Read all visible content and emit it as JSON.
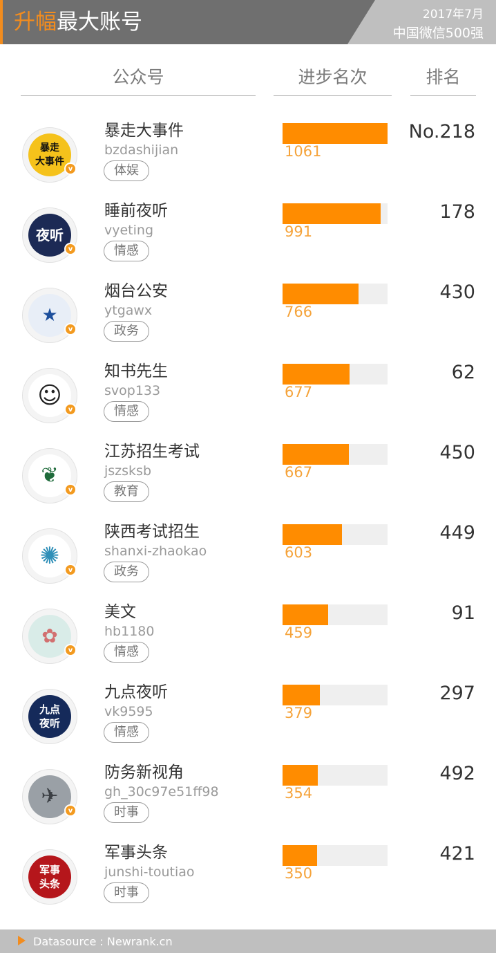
{
  "header": {
    "title_highlight": "升幅",
    "title_rest": "最大账号",
    "period": "2017年7月",
    "subtitle": "中国微信500强",
    "accent_color": "#f28c1e"
  },
  "columns": {
    "account": "公众号",
    "progress": "进步名次",
    "rank": "排名"
  },
  "rows": [
    {
      "name": "暴走大事件",
      "handle": "bzdashijian",
      "tag": "体娱",
      "progress": 1061,
      "rank": "No.218",
      "verified_icon": "v-badge-icon",
      "avatar_icon": "baozou-logo"
    },
    {
      "name": "睡前夜听",
      "handle": "vyeting",
      "tag": "情感",
      "progress": 991,
      "rank": "178",
      "verified_icon": "v-badge-icon",
      "avatar_icon": "yeting-logo"
    },
    {
      "name": "烟台公安",
      "handle": "ytgawx",
      "tag": "政务",
      "progress": 766,
      "rank": "430",
      "verified_icon": "v-badge-icon",
      "avatar_icon": "police-badge-logo"
    },
    {
      "name": "知书先生",
      "handle": "svop133",
      "tag": "情感",
      "progress": 677,
      "rank": "62",
      "verified_icon": "v-badge-icon",
      "avatar_icon": "sketch-portrait"
    },
    {
      "name": "江苏招生考试",
      "handle": "jszsksb",
      "tag": "教育",
      "progress": 667,
      "rank": "450",
      "verified_icon": "v-badge-icon",
      "avatar_icon": "wreath-emblem"
    },
    {
      "name": "陕西考试招生",
      "handle": "shanxi-zhaokao",
      "tag": "政务",
      "progress": 603,
      "rank": "449",
      "verified_icon": "v-badge-icon",
      "avatar_icon": "pinwheel-emblem"
    },
    {
      "name": "美文",
      "handle": "hb1180",
      "tag": "情感",
      "progress": 459,
      "rank": "91",
      "verified_icon": "v-badge-icon",
      "avatar_icon": "flower-logo"
    },
    {
      "name": "九点夜听",
      "handle": "vk9595",
      "tag": "情感",
      "progress": 379,
      "rank": "297",
      "verified_icon": "",
      "avatar_icon": "jiudian-logo"
    },
    {
      "name": "防务新视角",
      "handle": "gh_30c97e51ff98",
      "tag": "时事",
      "progress": 354,
      "rank": "492",
      "verified_icon": "v-badge-icon",
      "avatar_icon": "fighter-jet-photo"
    },
    {
      "name": "军事头条",
      "handle": "junshi-toutiao",
      "tag": "时事",
      "progress": 350,
      "rank": "421",
      "verified_icon": "",
      "avatar_icon": "junshi-logo"
    }
  ],
  "progress_max": 1061,
  "bar_color": "#ff8c00",
  "footer": {
    "source": "Datasource : Newrank.cn"
  }
}
